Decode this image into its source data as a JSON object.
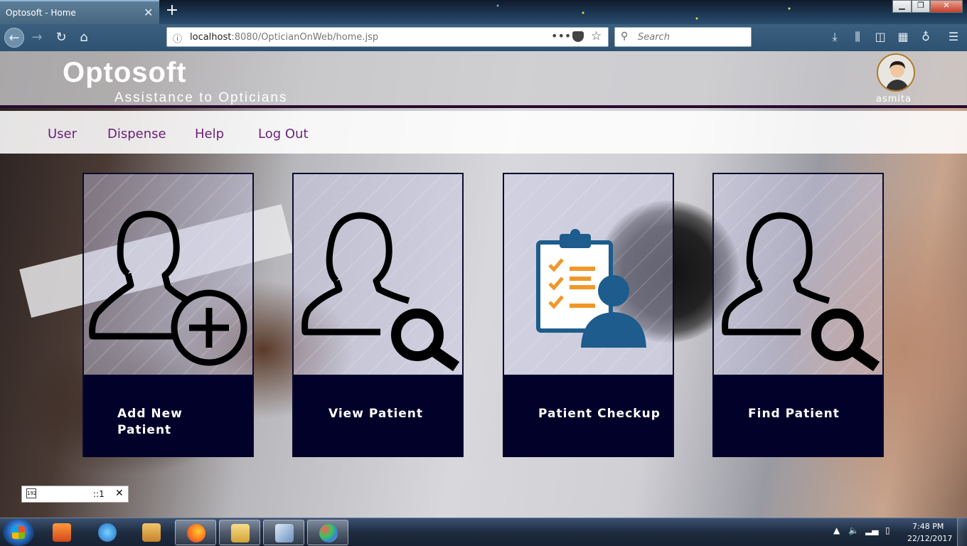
{
  "browser": {
    "tab_title": "Optosoft - Home",
    "tab_close": "✕",
    "new_tab": "+",
    "url_host": "localhost",
    "url_rest": ":8080/OpticianOnWeb/home.jsp",
    "url_more": "•••",
    "search_placeholder": "Search",
    "window_min": "▁",
    "window_max": "❐",
    "window_close": "✕"
  },
  "header": {
    "brand": "Optosoft",
    "tagline": "Assistance to Opticians",
    "username": "asmita"
  },
  "menu": {
    "items": [
      "User",
      "Dispense",
      "Help",
      "Log Out"
    ]
  },
  "cards": [
    {
      "label_line1": "Add New",
      "label_line2": "Patient",
      "icon": "add-user-icon"
    },
    {
      "label_line1": "View Patient",
      "label_line2": "",
      "icon": "user-search-icon"
    },
    {
      "label_line1": "Patient Checkup",
      "label_line2": "",
      "icon": "clipboard-checklist-icon"
    },
    {
      "label_line1": "Find Patient",
      "label_line2": "",
      "icon": "user-search-icon"
    }
  ],
  "ime": {
    "text": "::1",
    "close": "✕"
  },
  "taskbar": {
    "time": "7:48 PM",
    "date": "22/12/2017"
  },
  "colors": {
    "menu_text": "#6b1f78",
    "card_footer": "#02012a",
    "header_border": "#2a0a2e",
    "checkup_blue": "#1d5c8c",
    "checkup_orange": "#f0972a"
  }
}
